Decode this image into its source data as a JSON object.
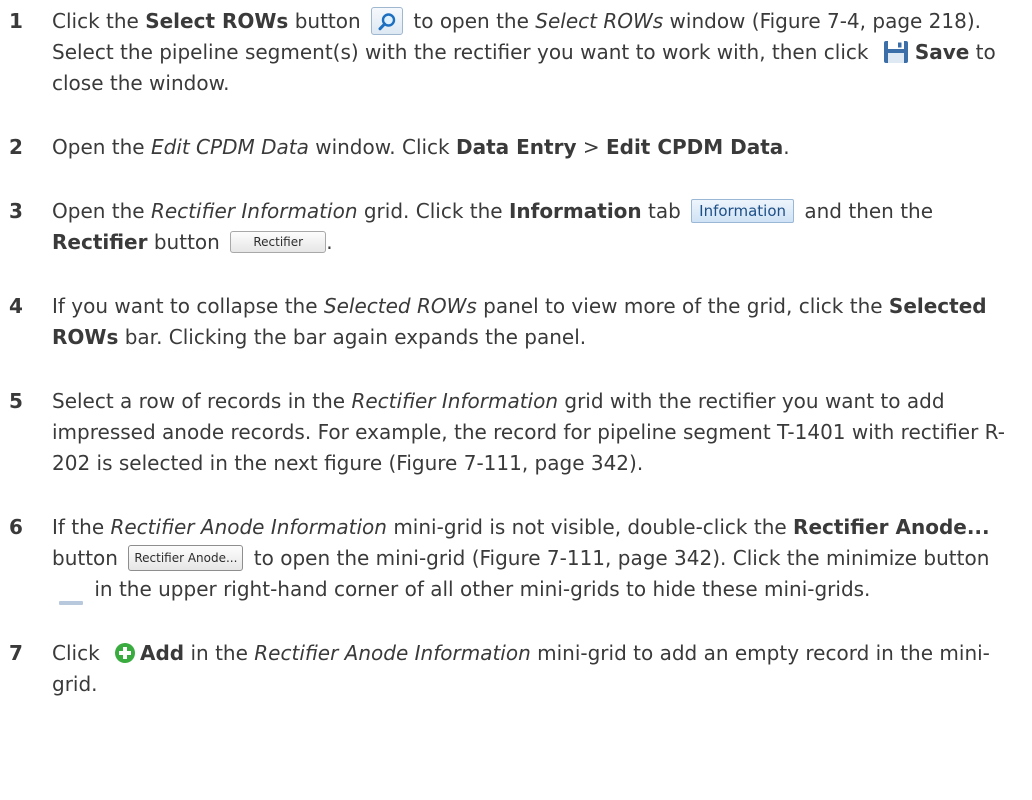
{
  "steps": [
    {
      "num": "1",
      "t1": "Click the ",
      "b1": "Select ROWs",
      "t2": " button ",
      "t3": " to open the ",
      "i1": "Select ROWs",
      "t4": " window (Figure 7-4, page 218). Select the pipeline segment(s) with the rectifier you want to work with, then click ",
      "b2": "Save",
      "t5": " to close the window."
    },
    {
      "num": "2",
      "t1": "Open the ",
      "i1": "Edit CPDM Data",
      "t2": " window. Click ",
      "b1": "Data Entry",
      "t3": " > ",
      "b2": "Edit CPDM Data",
      "t4": "."
    },
    {
      "num": "3",
      "t1": "Open the ",
      "i1": "Rectifier Information",
      "t2": " grid. Click the ",
      "b1": "Information",
      "t3": " tab ",
      "tab_label": "Information",
      "t4": " and then the ",
      "b2": "Rectifier",
      "t5": " button ",
      "button_label": "Rectifier",
      "t6": "."
    },
    {
      "num": "4",
      "t1": "If you want to collapse the ",
      "i1": "Selected ROWs",
      "t2": " panel to view more of the grid, click the ",
      "b1": "Selected ROWs",
      "t3": " bar. Clicking the bar again expands the panel."
    },
    {
      "num": "5",
      "t1": "Select a row of records in the ",
      "i1": "Rectifier Information",
      "t2": " grid with the rectifier you want to add impressed anode records. For example, the record for pipeline segment T-1401 with rectifier R-202 is selected in the next figure (Figure 7-111, page 342)."
    },
    {
      "num": "6",
      "t1": "If the ",
      "i1": "Rectifier Anode Information",
      "t2": " mini-grid is not visible, double-click the ",
      "b1": "Rectifier Anode...",
      "t3": " button ",
      "button_label": "Rectifier Anode...",
      "t4": " to open the mini-grid (Figure 7-111, page 342). Click the minimize button ",
      "t5": " in the upper right-hand corner of all other mini-grids to hide these mini-grids."
    },
    {
      "num": "7",
      "t1": "Click ",
      "b1": "Add",
      "t2": " in the ",
      "i1": "Rectifier Anode Information",
      "t3": " mini-grid to add an empty record in the mini-grid."
    }
  ],
  "icons": {
    "select_rows": "magnifier-icon",
    "save": "floppy-disk-icon",
    "minimize": "minimize-icon",
    "add": "green-plus-circle-icon"
  }
}
